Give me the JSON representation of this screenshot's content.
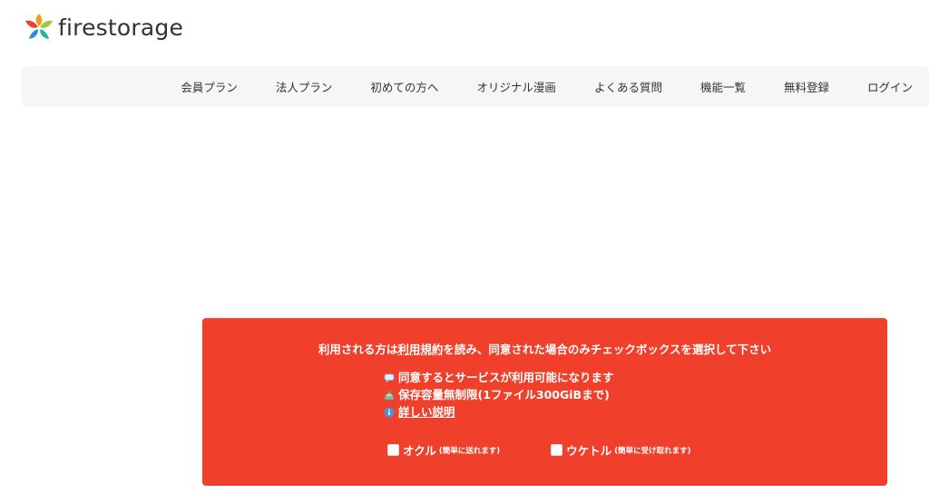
{
  "brand": {
    "logo_text": "firestorage"
  },
  "nav": {
    "items": [
      {
        "label": "会員プラン"
      },
      {
        "label": "法人プラン"
      },
      {
        "label": "初めての方へ"
      },
      {
        "label": "オリジナル漫画"
      },
      {
        "label": "よくある質問"
      },
      {
        "label": "機能一覧"
      },
      {
        "label": "無料登録"
      },
      {
        "label": "ログイン"
      }
    ]
  },
  "notice": {
    "head_prefix": "利用される方は",
    "terms_link": "利用規約",
    "head_suffix": "を読み、同意された場合のみチェックボックスを選択して下さい",
    "features": [
      {
        "icon": "speech-bubble-icon",
        "text": "同意するとサービスが利用可能になります"
      },
      {
        "icon": "storage-icon",
        "text": "保存容量無制限(1ファイル300GiBまで)"
      },
      {
        "icon": "info-icon",
        "text": "詳しい説明"
      }
    ],
    "checkboxes": [
      {
        "label": "オクル",
        "sub": "(簡単に送れます)",
        "checked": false
      },
      {
        "label": "ウケトル",
        "sub": "(簡単に受け取れます)",
        "checked": false
      }
    ]
  },
  "colors": {
    "notice_bg": "#f03f2b",
    "nav_bg": "#f4f6f7"
  }
}
